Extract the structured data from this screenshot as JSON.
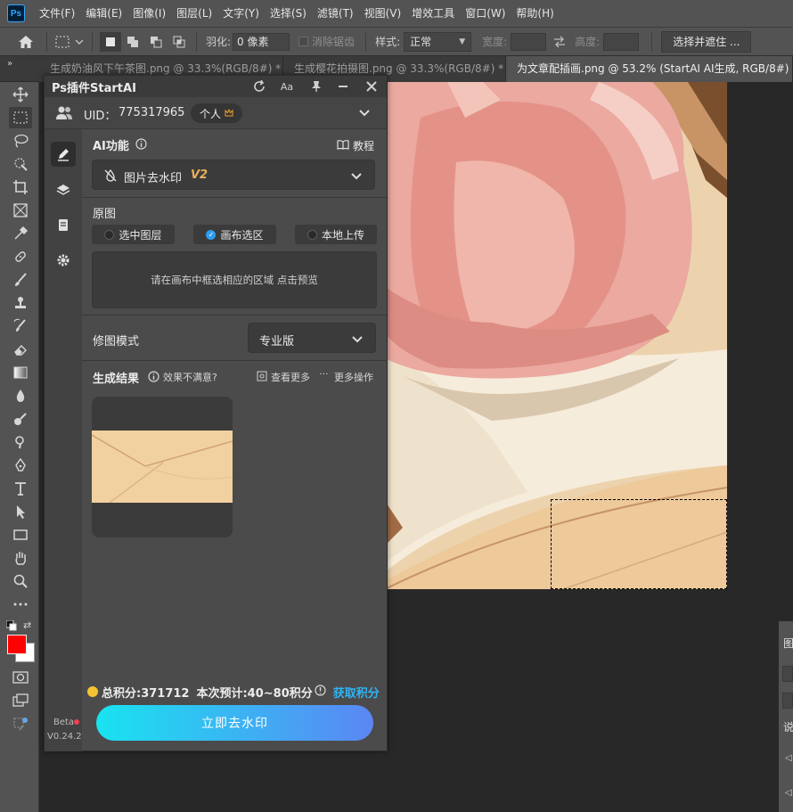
{
  "app": {
    "logo": "Ps"
  },
  "menu": [
    "文件(F)",
    "编辑(E)",
    "图像(I)",
    "图层(L)",
    "文字(Y)",
    "选择(S)",
    "滤镜(T)",
    "视图(V)",
    "增效工具",
    "窗口(W)",
    "帮助(H)"
  ],
  "options": {
    "feather_label": "羽化:",
    "feather_value": "0 像素",
    "antialias_label": "消除锯齿",
    "style_label": "样式:",
    "style_value": "正常",
    "width_label": "宽度:",
    "height_label": "高度:",
    "select_mask_label": "选择并遮住 ..."
  },
  "tabs": [
    {
      "label": "生成奶油风下午茶图.png @ 33.3%(RGB/8#) *",
      "active": false
    },
    {
      "label": "生成樱花拍摄图.png @ 33.3%(RGB/8#) *",
      "active": false
    },
    {
      "label": "为文章配插画.png @ 53.2% (StartAI AI生成, RGB/8#) *",
      "active": true
    }
  ],
  "tab_close_glyph": "×",
  "colors": {
    "foreground": "#ff0000",
    "background": "#ffffff",
    "accent": "#2d9cf0",
    "button_gradient_start": "#19e3f0",
    "button_gradient_end": "#5b86f5",
    "link": "#2fb4f5"
  },
  "plugin": {
    "title": "Ps插件StartAI",
    "uid_label": "UID：",
    "uid_value": "775317965",
    "plan_badge": "个人",
    "ai_function_label": "AI功能",
    "tutorial_label": "教程",
    "feature_selected": "图片去水印",
    "feature_version": "V2",
    "source_label": "原图",
    "source_options": [
      {
        "label": "选中图层",
        "checked": false
      },
      {
        "label": "画布选区",
        "checked": true
      },
      {
        "label": "本地上传",
        "checked": false
      }
    ],
    "source_hint": "请在画布中框选相应的区域 点击预览",
    "mode_label": "修图模式",
    "mode_value": "专业版",
    "result_label": "生成结果",
    "result_feedback": "效果不满意?",
    "view_more": "查看更多",
    "more_actions": "更多操作",
    "points_label": "总积分:371712",
    "estimate_label": "本次预计:40~80积分",
    "get_points": "获取积分",
    "primary_action": "立即去水印",
    "beta_label": "Beta",
    "version": "V0.24.2"
  },
  "right_dock": {
    "chars": [
      "图",
      "说"
    ]
  }
}
